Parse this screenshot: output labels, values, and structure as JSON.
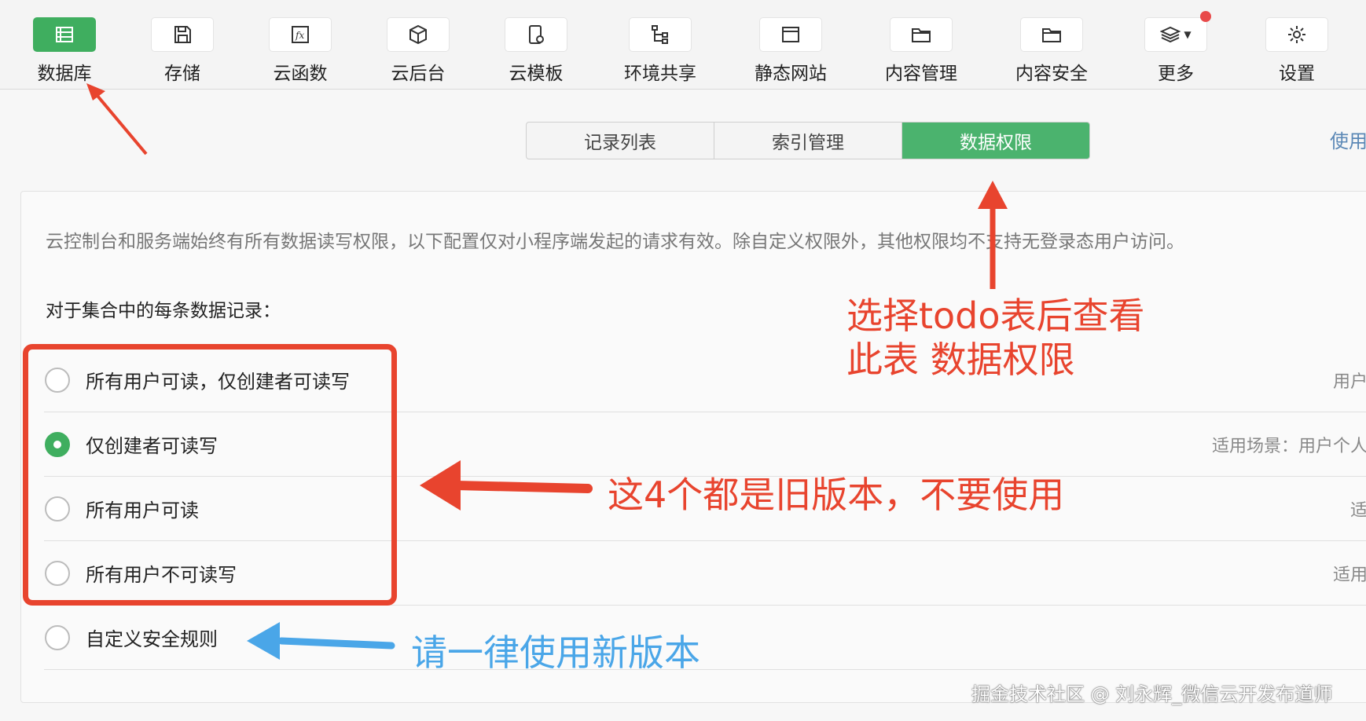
{
  "toolbar": {
    "items": [
      {
        "label": "数据库",
        "icon": "database-icon"
      },
      {
        "label": "存储",
        "icon": "save-icon"
      },
      {
        "label": "云函数",
        "icon": "function-icon"
      },
      {
        "label": "云后台",
        "icon": "cube-icon"
      },
      {
        "label": "云模板",
        "icon": "template-icon"
      },
      {
        "label": "环境共享",
        "icon": "tree-icon"
      },
      {
        "label": "静态网站",
        "icon": "window-icon"
      },
      {
        "label": "内容管理",
        "icon": "folder-icon"
      },
      {
        "label": "内容安全",
        "icon": "folder-icon"
      },
      {
        "label": "更多",
        "icon": "layers-icon"
      },
      {
        "label": "设置",
        "icon": "gear-icon"
      }
    ],
    "active_color": "#3fae5f",
    "badge_color": "#e84a4a"
  },
  "tabs": [
    {
      "label": "记录列表"
    },
    {
      "label": "索引管理"
    },
    {
      "label": "数据权限"
    }
  ],
  "top_link": "使用",
  "notice": "云控制台和服务端始终有所有数据读写权限，以下配置仅对小程序端发起的请求有效。除自定义权限外，其他权限均不支持无登录态用户访问。",
  "section_label": "对于集合中的每条数据记录：",
  "options": [
    {
      "label": "所有用户可读，仅创建者可读写",
      "desc": "用户",
      "checked": false
    },
    {
      "label": "仅创建者可读写",
      "desc": "适用场景：用户个人",
      "checked": true
    },
    {
      "label": "所有用户可读",
      "desc": "适",
      "checked": false
    },
    {
      "label": "所有用户不可读写",
      "desc": "适用",
      "checked": false
    },
    {
      "label": "自定义安全规则",
      "desc": "",
      "checked": false
    }
  ],
  "annotations": {
    "select_table_line1": "选择todo表后查看",
    "select_table_line2": "此表 数据权限",
    "old_versions": "这4个都是旧版本，不要使用",
    "use_new": "请一律使用新版本",
    "red": "#e8442e",
    "blue": "#4aa6e8"
  },
  "watermark": "掘金技术社区 @ 刘永辉_微信云开发布道师"
}
